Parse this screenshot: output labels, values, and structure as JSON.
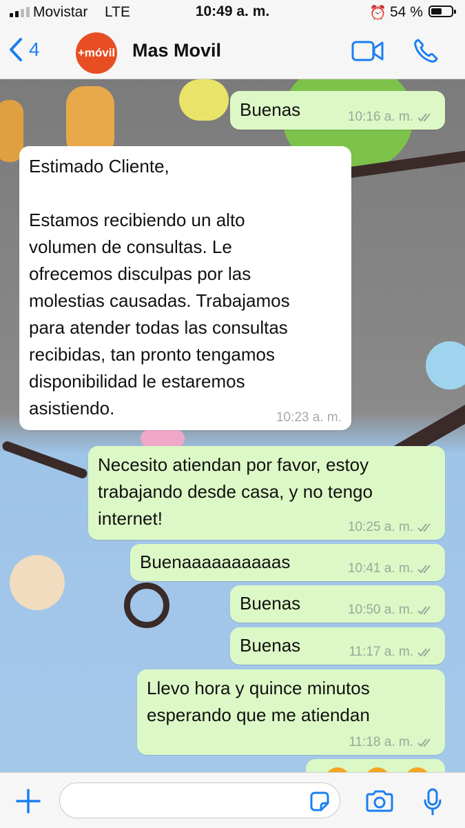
{
  "status_bar": {
    "carrier": "Movistar",
    "network": "LTE",
    "time": "10:49 a. m.",
    "battery": "54 %",
    "battery_level": 0.54
  },
  "header": {
    "back_count": "4",
    "avatar_text": "+móvil",
    "contact_name": "Mas Movil",
    "icons": [
      "chevron-left-icon",
      "video-call-icon",
      "phone-icon"
    ],
    "accent_color": "#1a7ff0",
    "avatar_color": "#e84e23"
  },
  "messages": [
    {
      "dir": "out",
      "text": "Buenas",
      "time": "10:16 a. m."
    },
    {
      "dir": "in",
      "text": "Estimado Cliente,\n\nEstamos recibiendo un alto\nvolumen de consultas. Le\nofrecemos disculpas por las\nmolestias causadas. Trabajamos\npara atender todas las consultas\nrecibidas, tan pronto tengamos\ndisponibilidad le estaremos\nasistiendo.",
      "time": "10:23 a. m."
    },
    {
      "dir": "out",
      "text": "Necesito atiendan por favor, estoy\ntrabajando desde casa, y no tengo\ninternet!",
      "time": "10:25 a. m."
    },
    {
      "dir": "out",
      "text": "Buenaaaaaaaaaas",
      "time": "10:41 a. m."
    },
    {
      "dir": "out",
      "text": "Buenas",
      "time": "10:50 a. m."
    },
    {
      "dir": "out",
      "text": "Buenas",
      "time": "11:17 a. m."
    },
    {
      "dir": "out",
      "text": "Llevo hora y quince minutos\nesperando que me atiendan",
      "time": "11:18 a. m."
    }
  ],
  "colors": {
    "outgoing_bubble": "#dcf8c6",
    "incoming_bubble": "#ffffff"
  },
  "input_bar": {
    "icons": [
      "plus-icon",
      "sticker-icon",
      "camera-icon",
      "microphone-icon"
    ]
  }
}
